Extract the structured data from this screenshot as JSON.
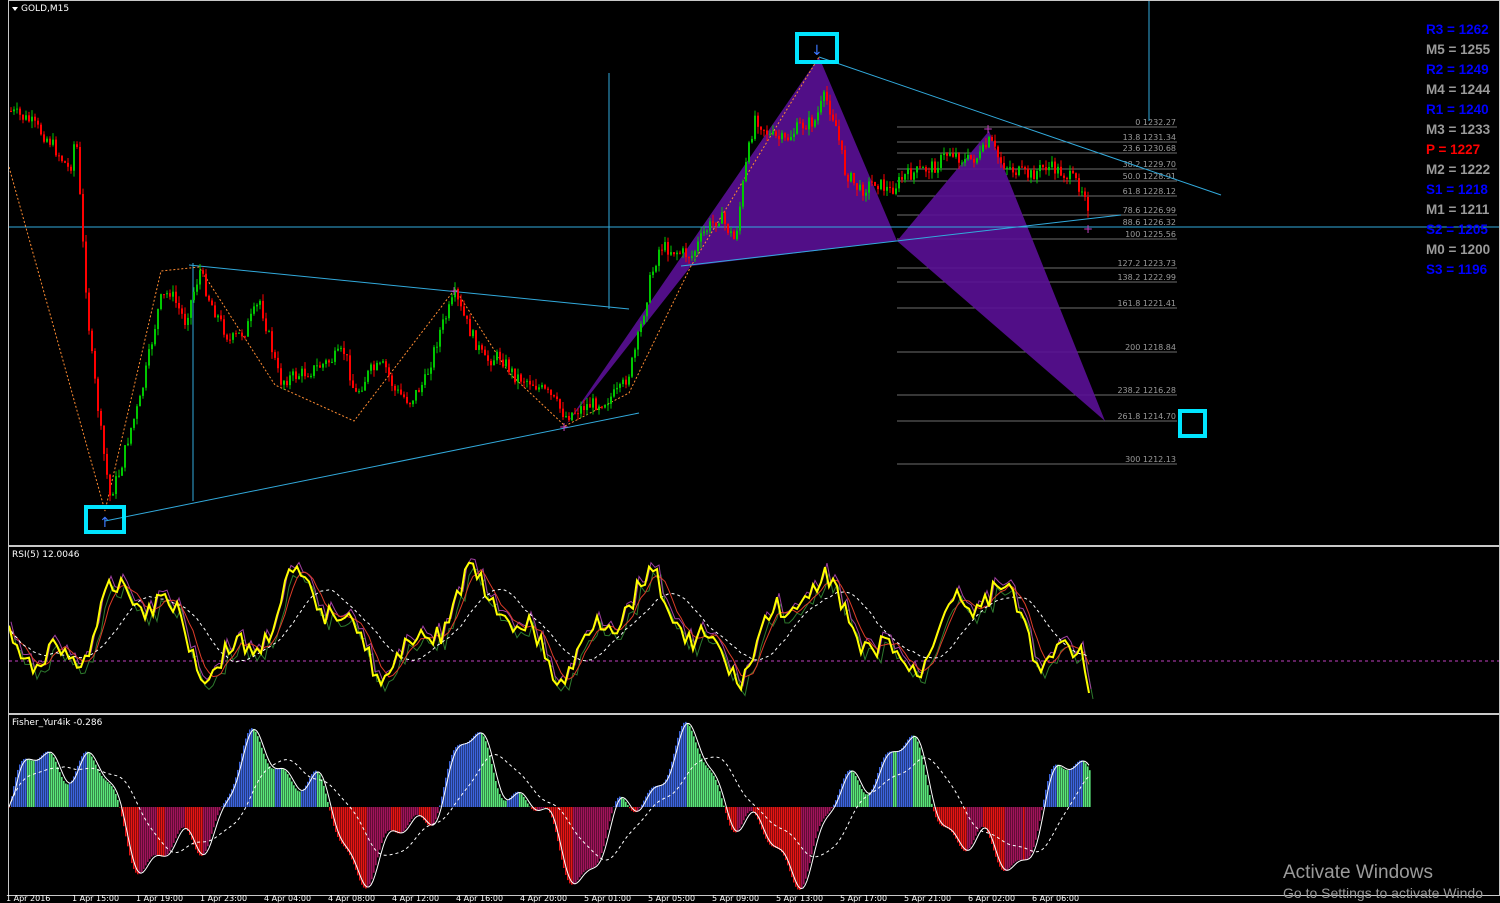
{
  "chart_title": "GOLD,M15",
  "rsi_label": "RSI(5) 12.0046",
  "fisher_label": "Fisher_Yur4ik -0.286",
  "fib_levels": [
    {
      "label": "0 1232.27"
    },
    {
      "label": "13.8 1231.34"
    },
    {
      "label": "23.6 1230.68"
    },
    {
      "label": "38.2 1229.70"
    },
    {
      "label": "50.0 1228.91"
    },
    {
      "label": "61.8 1228.12"
    },
    {
      "label": "78.6 1226.99"
    },
    {
      "label": "88.6 1226.32"
    },
    {
      "label": "100 1225.56"
    },
    {
      "label": "127.2 1223.73"
    },
    {
      "label": "138.2 1222.99"
    },
    {
      "label": "161.8 1221.41"
    },
    {
      "label": "200 1218.84"
    },
    {
      "label": "238.2 1216.28"
    },
    {
      "label": "261.8 1214.70"
    },
    {
      "label": "300 1212.13"
    }
  ],
  "pivots": [
    {
      "label": "R3 = 1262",
      "color": "#0000ff"
    },
    {
      "label": "M5 = 1255",
      "color": "#9a9a9a"
    },
    {
      "label": "R2 = 1249",
      "color": "#0000ff"
    },
    {
      "label": "M4 = 1244",
      "color": "#9a9a9a"
    },
    {
      "label": "R1 = 1240",
      "color": "#0000ff"
    },
    {
      "label": "M3 = 1233",
      "color": "#9a9a9a"
    },
    {
      "label": "P   = 1227",
      "color": "#ff0000"
    },
    {
      "label": "M2 = 1222",
      "color": "#9a9a9a"
    },
    {
      "label": "S1 = 1218",
      "color": "#0000ff"
    },
    {
      "label": "M1 = 1211",
      "color": "#9a9a9a"
    },
    {
      "label": "S2 = 1205",
      "color": "#0000ff"
    },
    {
      "label": "M0 = 1200",
      "color": "#9a9a9a"
    },
    {
      "label": "S3 = 1196",
      "color": "#0000ff"
    }
  ],
  "time_labels": [
    "1 Apr 2016",
    "1 Apr 15:00",
    "1 Apr 19:00",
    "1 Apr 23:00",
    "4 Apr 04:00",
    "4 Apr 08:00",
    "4 Apr 12:00",
    "4 Apr 16:00",
    "4 Apr 20:00",
    "5 Apr 01:00",
    "5 Apr 05:00",
    "5 Apr 09:00",
    "5 Apr 13:00",
    "5 Apr 17:00",
    "5 Apr 21:00",
    "6 Apr 02:00",
    "6 Apr 06:00"
  ],
  "watermark": {
    "line1": "Activate Windows",
    "line2": "Go to Settings to activate Windo"
  },
  "colors": {
    "bull": "#00c800",
    "bear": "#ff0000",
    "pattern": "#5a0f96",
    "trendline": "#32aadc",
    "marker_box": "#00e5ff",
    "rsi": "#ffff00",
    "fisher_up": "#3c64dc",
    "fisher_up_weak": "#5ae67a",
    "fisher_down": "#a0145a",
    "fisher_down_strong": "#e61414"
  }
}
